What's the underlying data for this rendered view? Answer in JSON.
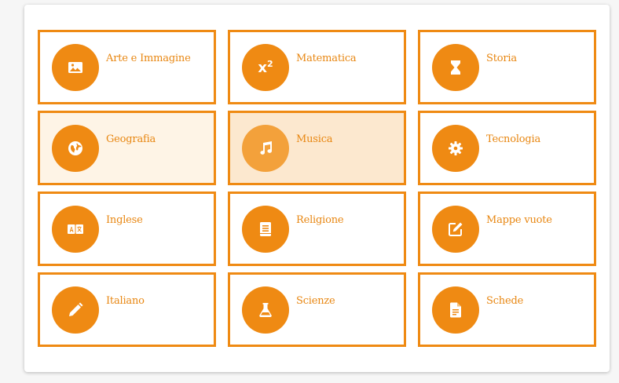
{
  "accent_color": "#ef8a13",
  "subjects": [
    {
      "label": "Arte e Immagine",
      "icon": "image-icon"
    },
    {
      "label": "Matematica",
      "icon": "x-squared-icon",
      "icon_text": "x",
      "icon_sup": "2"
    },
    {
      "label": "Storia",
      "icon": "hourglass-icon"
    },
    {
      "label": "Geografia",
      "icon": "globe-icon"
    },
    {
      "label": "Musica",
      "icon": "music-note-icon"
    },
    {
      "label": "Tecnologia",
      "icon": "gear-icon"
    },
    {
      "label": "Inglese",
      "icon": "translate-icon"
    },
    {
      "label": "Religione",
      "icon": "book-icon"
    },
    {
      "label": "Mappe vuote",
      "icon": "edit-icon"
    },
    {
      "label": "Italiano",
      "icon": "pencil-icon"
    },
    {
      "label": "Scienze",
      "icon": "flask-icon"
    },
    {
      "label": "Schede",
      "icon": "document-icon"
    }
  ]
}
